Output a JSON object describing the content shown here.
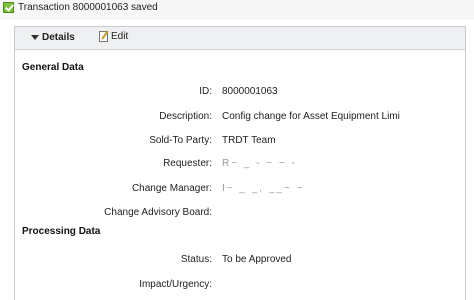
{
  "message": {
    "text": "Transaction 8000001063 saved"
  },
  "toolbar": {
    "details_label": "Details",
    "edit_label": "Edit"
  },
  "sections": {
    "general": "General Data",
    "processing": "Processing Data"
  },
  "fields": {
    "id": {
      "label": "ID:",
      "value": "8000001063"
    },
    "description": {
      "label": "Description:",
      "value": "Config change for Asset Equipment Limi"
    },
    "sold_to": {
      "label": "Sold-To Party:",
      "value": "TRDT Team"
    },
    "requester": {
      "label": "Requester:",
      "value": "R~ _ - ~ ~ -"
    },
    "change_manager": {
      "label": "Change Manager:",
      "value": "I~ _ _, __~ ~"
    },
    "cab": {
      "label": "Change Advisory Board:",
      "value": ""
    },
    "status": {
      "label": "Status:",
      "value": "To be Approved"
    },
    "impact": {
      "label": "Impact/Urgency:",
      "value": ""
    }
  }
}
